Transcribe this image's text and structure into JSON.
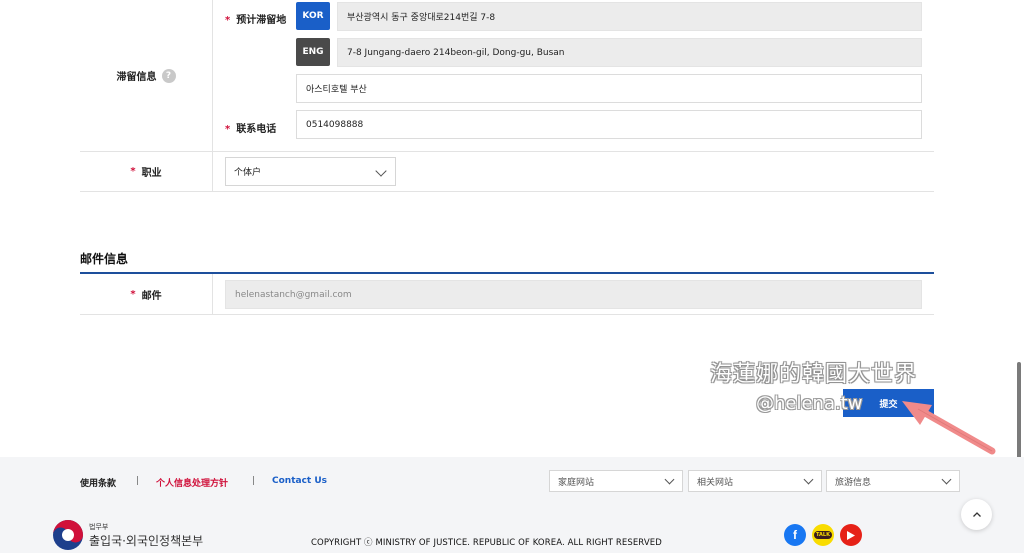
{
  "stay": {
    "label": "滞留信息",
    "help_icon": "?",
    "planned_label": "预计滞留地",
    "kor_tag": "KOR",
    "eng_tag": "ENG",
    "address_kor": "부산광역시 동구 중앙대로214번길 7-8",
    "address_eng": "7-8 Jungang-daero 214beon-gil, Dong-gu, Busan",
    "address_detail": "아스티호텔 부산",
    "phone_label": "联系电话",
    "phone_value": "0514098888"
  },
  "occupation": {
    "label": "职业",
    "selected": "个体户"
  },
  "email_section": {
    "title": "邮件信息",
    "label": "邮件",
    "value": "helenastanch@gmail.com"
  },
  "required_mark": "*",
  "submit_label": "提交",
  "watermark": {
    "line1": "海蓮娜的韓國大世界",
    "line2": "@helena.tw"
  },
  "footer": {
    "terms": "使用条款",
    "privacy": "个人信息处理方针",
    "contact": "Contact Us",
    "separator": "|",
    "family_sites": "家庭网站",
    "related_sites": "相关网站",
    "travel_info": "旅游信息",
    "logo_small": "법무부",
    "logo_main": "출입국·외국인정책본부",
    "copyright": "COPYRIGHT ⓒ MINISTRY OF JUSTICE. REPUBLIC OF KOREA. ALL RIGHT RESERVED",
    "kakao_label": "TALK"
  },
  "colors": {
    "primary_blue": "#1a5fc8",
    "required_red": "#d0103a",
    "footer_bg": "#f4f5f7",
    "arrow": "#f08a8a"
  },
  "icons": [
    "help-icon",
    "chevron-down-icon",
    "facebook-icon",
    "kakaotalk-icon",
    "youtube-icon",
    "arrow-up-icon",
    "annotation-arrow"
  ]
}
